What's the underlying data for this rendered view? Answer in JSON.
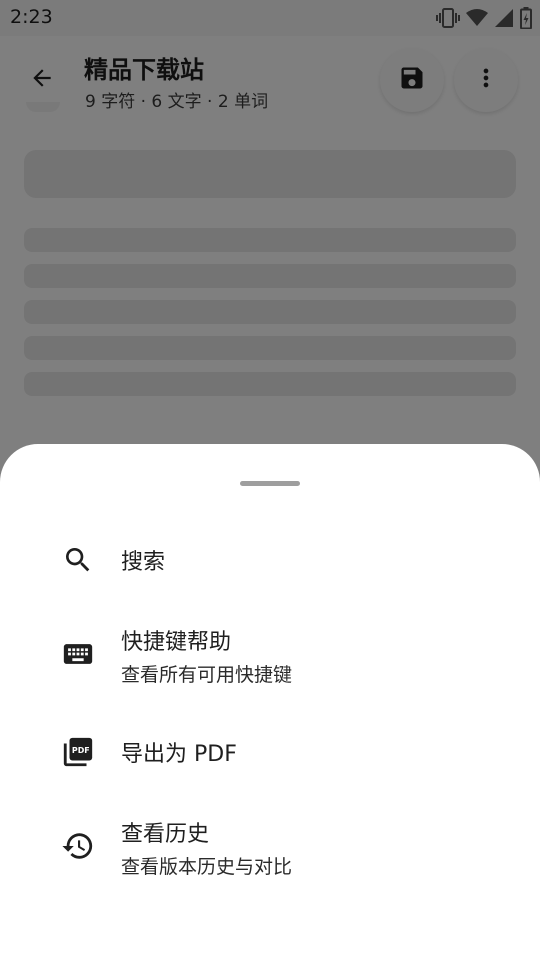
{
  "status_bar": {
    "time": "2:23",
    "icons": [
      "vibrate-icon",
      "wifi-icon",
      "signal-icon",
      "battery-icon"
    ]
  },
  "app_bar": {
    "title": "精品下载站",
    "subtitle": "9 字符 · 6 文字 · 2 单词",
    "back_icon": "arrow-back-icon",
    "save_icon": "save-icon",
    "more_icon": "more-vert-icon"
  },
  "sheet": {
    "items": [
      {
        "label": "搜索",
        "icon": "search-icon"
      },
      {
        "label": "快捷键帮助",
        "sublabel": "查看所有可用快捷键",
        "icon": "keyboard-icon"
      },
      {
        "label": "导出为 PDF",
        "icon": "pdf-icon"
      },
      {
        "label": "查看历史",
        "sublabel": "查看版本历史与对比",
        "icon": "history-icon"
      }
    ]
  },
  "colors": {
    "text_primary": "#1f1f1f",
    "scrim": "#000000",
    "skeleton": "#e8e8e8"
  }
}
